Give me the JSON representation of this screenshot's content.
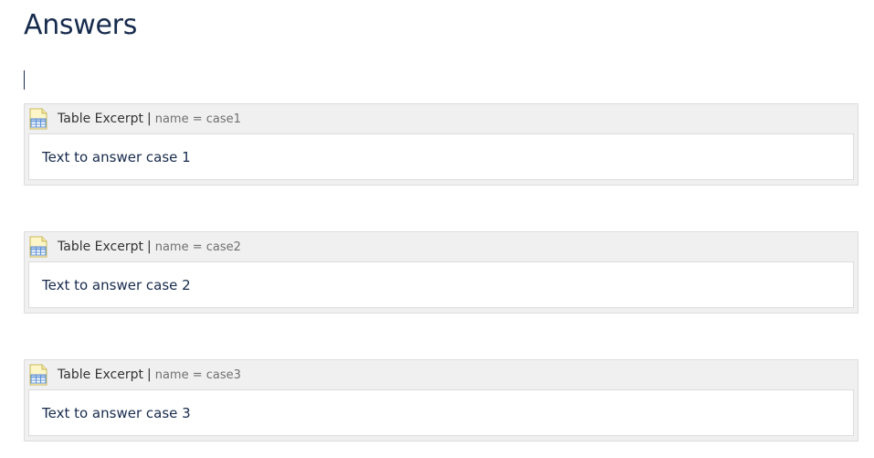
{
  "page": {
    "title": "Answers"
  },
  "macros": [
    {
      "macro_name": "Table Excerpt",
      "separator": "|",
      "param": "name = case1",
      "body_text": "Text to answer case 1",
      "icon": "table-excerpt-icon"
    },
    {
      "macro_name": "Table Excerpt",
      "separator": "|",
      "param": "name = case2",
      "body_text": "Text to answer case 2",
      "icon": "table-excerpt-icon"
    },
    {
      "macro_name": "Table Excerpt",
      "separator": "|",
      "param": "name = case3",
      "body_text": "Text to answer case 3",
      "icon": "table-excerpt-icon"
    }
  ],
  "colors": {
    "title": "#172b4d",
    "macro_header_bg": "#f0f0f0",
    "macro_border": "#dcdcdc",
    "param_text": "#707070"
  }
}
